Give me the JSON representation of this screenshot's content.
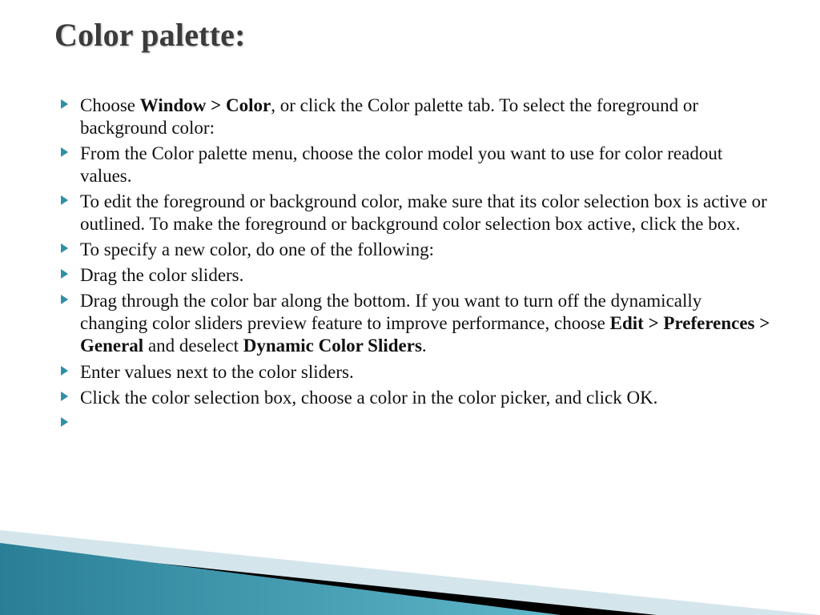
{
  "title": "Color palette:",
  "bullets": [
    {
      "pre": "Choose ",
      "bold1": "Window > Color",
      "mid1": ", or click the Color palette tab. To select the foreground or background color:"
    },
    {
      "pre": "From the Color palette menu, choose the color model you want to use for color readout values."
    },
    {
      "pre": "To edit the foreground or background color, make sure that its color selection box is active or outlined. To make the foreground or background color selection box active, click the box."
    },
    {
      "pre": "To specify a new color, do one of the following:"
    },
    {
      "pre": "Drag the color sliders."
    },
    {
      "pre": "Drag through the color bar along the bottom. If you want to turn off the dynamically changing color sliders preview feature to improve performance, choose ",
      "bold1": "Edit > Preferences > General",
      "mid1": " and deselect ",
      "bold2": "Dynamic Color Sliders",
      "post": "."
    },
    {
      "pre": "Enter values next to the color sliders."
    },
    {
      "pre": "Click the color selection box, choose a color in the color picker, and click OK."
    },
    {
      "pre": ""
    }
  ]
}
